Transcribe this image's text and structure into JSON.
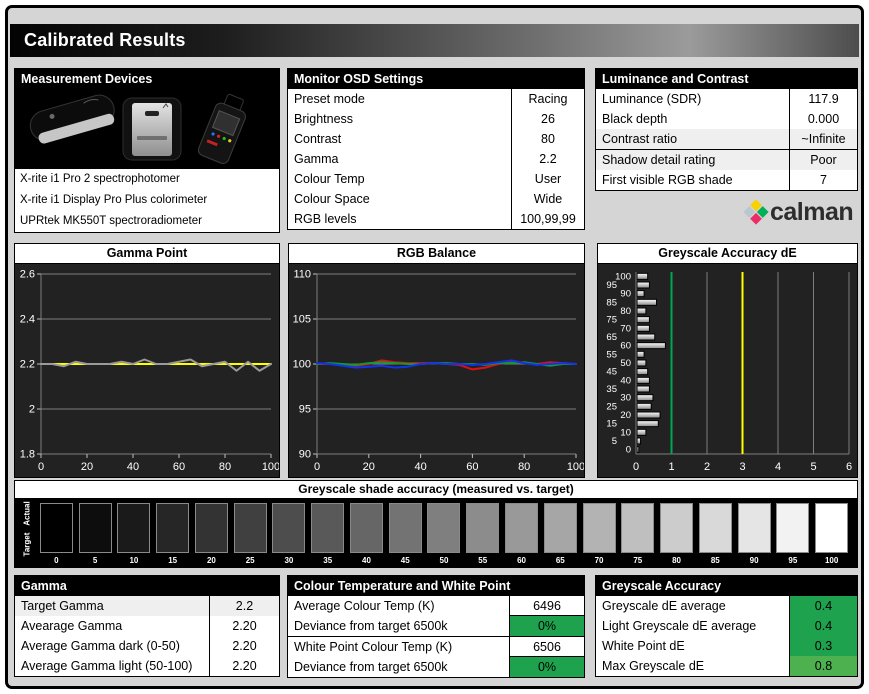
{
  "page": {
    "title": "Calibrated Results"
  },
  "colors": {
    "good": "#1fa24e",
    "good_light": "#4db14f",
    "target_line": "#ffff00",
    "measured_line": "#9b9b9b",
    "red_line": "#dd1111",
    "green_line": "#0f9b30",
    "blue_line": "#1133ee",
    "ref_green": "#00a651",
    "ref_yellow": "#ffff00"
  },
  "panels": {
    "measurement_devices": {
      "title": "Measurement Devices",
      "items": [
        "X-rite i1 Pro 2 spectrophotomer",
        "X-rite i1 Display Pro Plus colorimeter",
        "UPRtek MK550T spectroradiometer"
      ]
    },
    "monitor_osd": {
      "title": "Monitor OSD Settings",
      "rows": [
        {
          "label": "Preset mode",
          "value": "Racing"
        },
        {
          "label": "Brightness",
          "value": "26"
        },
        {
          "label": "Contrast",
          "value": "80"
        },
        {
          "label": "Gamma",
          "value": "2.2"
        },
        {
          "label": "Colour Temp",
          "value": "User"
        },
        {
          "label": "Colour Space",
          "value": "Wide"
        },
        {
          "label": "RGB levels",
          "value": "100,99,99"
        }
      ]
    },
    "luminance": {
      "title": "Luminance and Contrast",
      "rows": [
        {
          "label": "Luminance (SDR)",
          "value": "117.9",
          "shaded": false,
          "divider_after": false
        },
        {
          "label": "Black depth",
          "value": "0.000",
          "shaded": false,
          "divider_after": false
        },
        {
          "label": "Contrast ratio",
          "value": "~Infinite",
          "shaded": true,
          "divider_after": true
        },
        {
          "label": "Shadow detail rating",
          "value": "Poor",
          "shaded": true,
          "divider_after": false
        },
        {
          "label": "First visible RGB shade",
          "value": "7",
          "shaded": false,
          "divider_after": false
        }
      ]
    },
    "gamma": {
      "title": "Gamma",
      "rows": [
        {
          "label": "Target Gamma",
          "value": "2.2",
          "shaded": true
        },
        {
          "label": "Avearage Gamma",
          "value": "2.20",
          "shaded": false
        },
        {
          "label": "Average Gamma dark (0-50)",
          "value": "2.20",
          "shaded": false
        },
        {
          "label": "Average Gamma light (50-100)",
          "value": "2.20",
          "shaded": false
        }
      ]
    },
    "colour_temp": {
      "title": "Colour Temperature and White Point",
      "rows": [
        {
          "label": "Average Colour Temp (K)",
          "value": "6496",
          "value_bg": "white",
          "divider_after": false
        },
        {
          "label": "Deviance from target 6500k",
          "value": "0%",
          "value_bg": "green",
          "divider_after": true
        },
        {
          "label": "White Point Colour Temp (K)",
          "value": "6506",
          "value_bg": "white",
          "divider_after": false
        },
        {
          "label": "Deviance from target 6500k",
          "value": "0%",
          "value_bg": "green",
          "divider_after": false
        }
      ]
    },
    "greyscale_accuracy": {
      "title": "Greyscale Accuracy",
      "rows": [
        {
          "label": "Greyscale dE average",
          "value": "0.4",
          "value_bg": "green"
        },
        {
          "label": "Light Greyscale dE average",
          "value": "0.4",
          "value_bg": "green"
        },
        {
          "label": "White Point dE",
          "value": "0.3",
          "value_bg": "green"
        },
        {
          "label": "Max Greyscale dE",
          "value": "0.8",
          "value_bg": "green_light"
        }
      ]
    }
  },
  "logo": {
    "text": "calman",
    "diamond_colors": [
      "#b9c7d0",
      "#f8d200",
      "#00b057",
      "#ed2d67"
    ]
  },
  "chart_data": [
    {
      "type": "line",
      "title": "Gamma Point",
      "x": [
        0,
        5,
        10,
        15,
        20,
        25,
        30,
        35,
        40,
        45,
        50,
        55,
        60,
        65,
        70,
        75,
        80,
        85,
        90,
        95,
        100
      ],
      "xticks": [
        0,
        20,
        40,
        60,
        80,
        100
      ],
      "yticks": [
        "1.8",
        "2",
        "2.2",
        "2.4",
        "2.6"
      ],
      "ylim": [
        1.8,
        2.6
      ],
      "grid": true,
      "series": [
        {
          "name": "target",
          "color": "#ffff00",
          "values": [
            2.2,
            2.2,
            2.2,
            2.2,
            2.2,
            2.2,
            2.2,
            2.2,
            2.2,
            2.2,
            2.2,
            2.2,
            2.2,
            2.2,
            2.2,
            2.2,
            2.2,
            2.2,
            2.2,
            2.2,
            2.2
          ]
        },
        {
          "name": "measured",
          "color": "#9b9b9b",
          "values": [
            2.2,
            2.2,
            2.19,
            2.21,
            2.2,
            2.2,
            2.2,
            2.21,
            2.2,
            2.22,
            2.2,
            2.2,
            2.21,
            2.22,
            2.19,
            2.2,
            2.21,
            2.17,
            2.21,
            2.17,
            2.2
          ]
        }
      ]
    },
    {
      "type": "line",
      "title": "RGB Balance",
      "x": [
        0,
        5,
        10,
        15,
        20,
        25,
        30,
        35,
        40,
        45,
        50,
        55,
        60,
        65,
        70,
        75,
        80,
        85,
        90,
        95,
        100
      ],
      "xticks": [
        0,
        20,
        40,
        60,
        80,
        100
      ],
      "yticks": [
        "90",
        "95",
        "100",
        "105",
        "110"
      ],
      "ylim": [
        90,
        110
      ],
      "grid": true,
      "series": [
        {
          "name": "red",
          "color": "#dd1111",
          "values": [
            100,
            100,
            99.9,
            99.8,
            100,
            100.4,
            100.2,
            100.1,
            100.1,
            100.1,
            100,
            99.9,
            99.4,
            99.6,
            100,
            100.2,
            100.1,
            100,
            100.2,
            100.1,
            100
          ]
        },
        {
          "name": "green",
          "color": "#0f9b30",
          "values": [
            100,
            100.1,
            100,
            99.9,
            100.1,
            100.2,
            100.1,
            100,
            100,
            100.1,
            100.1,
            100,
            100,
            99.9,
            100.1,
            100.1,
            100.2,
            100,
            99.8,
            100,
            100
          ]
        },
        {
          "name": "blue",
          "color": "#1133ee",
          "values": [
            100.1,
            100,
            99.8,
            99.6,
            99.7,
            99.8,
            99.6,
            99.7,
            100,
            100.1,
            100,
            100,
            99.9,
            100,
            100.2,
            100.4,
            100.1,
            99.9,
            100,
            100.1,
            100
          ]
        }
      ]
    },
    {
      "type": "bar",
      "orientation": "horizontal",
      "title": "Greyscale Accuracy dE",
      "categories": [
        100,
        95,
        90,
        85,
        80,
        75,
        70,
        65,
        60,
        55,
        50,
        45,
        40,
        35,
        30,
        25,
        20,
        15,
        10,
        5,
        0
      ],
      "values": [
        0.3,
        0.35,
        0.2,
        0.55,
        0.25,
        0.35,
        0.35,
        0.5,
        0.8,
        0.2,
        0.25,
        0.3,
        0.35,
        0.35,
        0.45,
        0.4,
        0.65,
        0.6,
        0.25,
        0.1,
        0.05
      ],
      "xlim": [
        0,
        6
      ],
      "xticks": [
        0,
        1,
        2,
        3,
        4,
        5,
        6
      ],
      "ref_lines": [
        {
          "value": 1,
          "color": "#00a651"
        },
        {
          "value": 3,
          "color": "#ffff00"
        }
      ]
    },
    {
      "type": "table",
      "title": "Greyscale shade accuracy (measured vs. target)",
      "row_labels": [
        "Actual",
        "Target"
      ],
      "levels": [
        0,
        5,
        10,
        15,
        20,
        25,
        30,
        35,
        40,
        45,
        50,
        55,
        60,
        65,
        70,
        75,
        80,
        85,
        90,
        95,
        100
      ]
    }
  ]
}
